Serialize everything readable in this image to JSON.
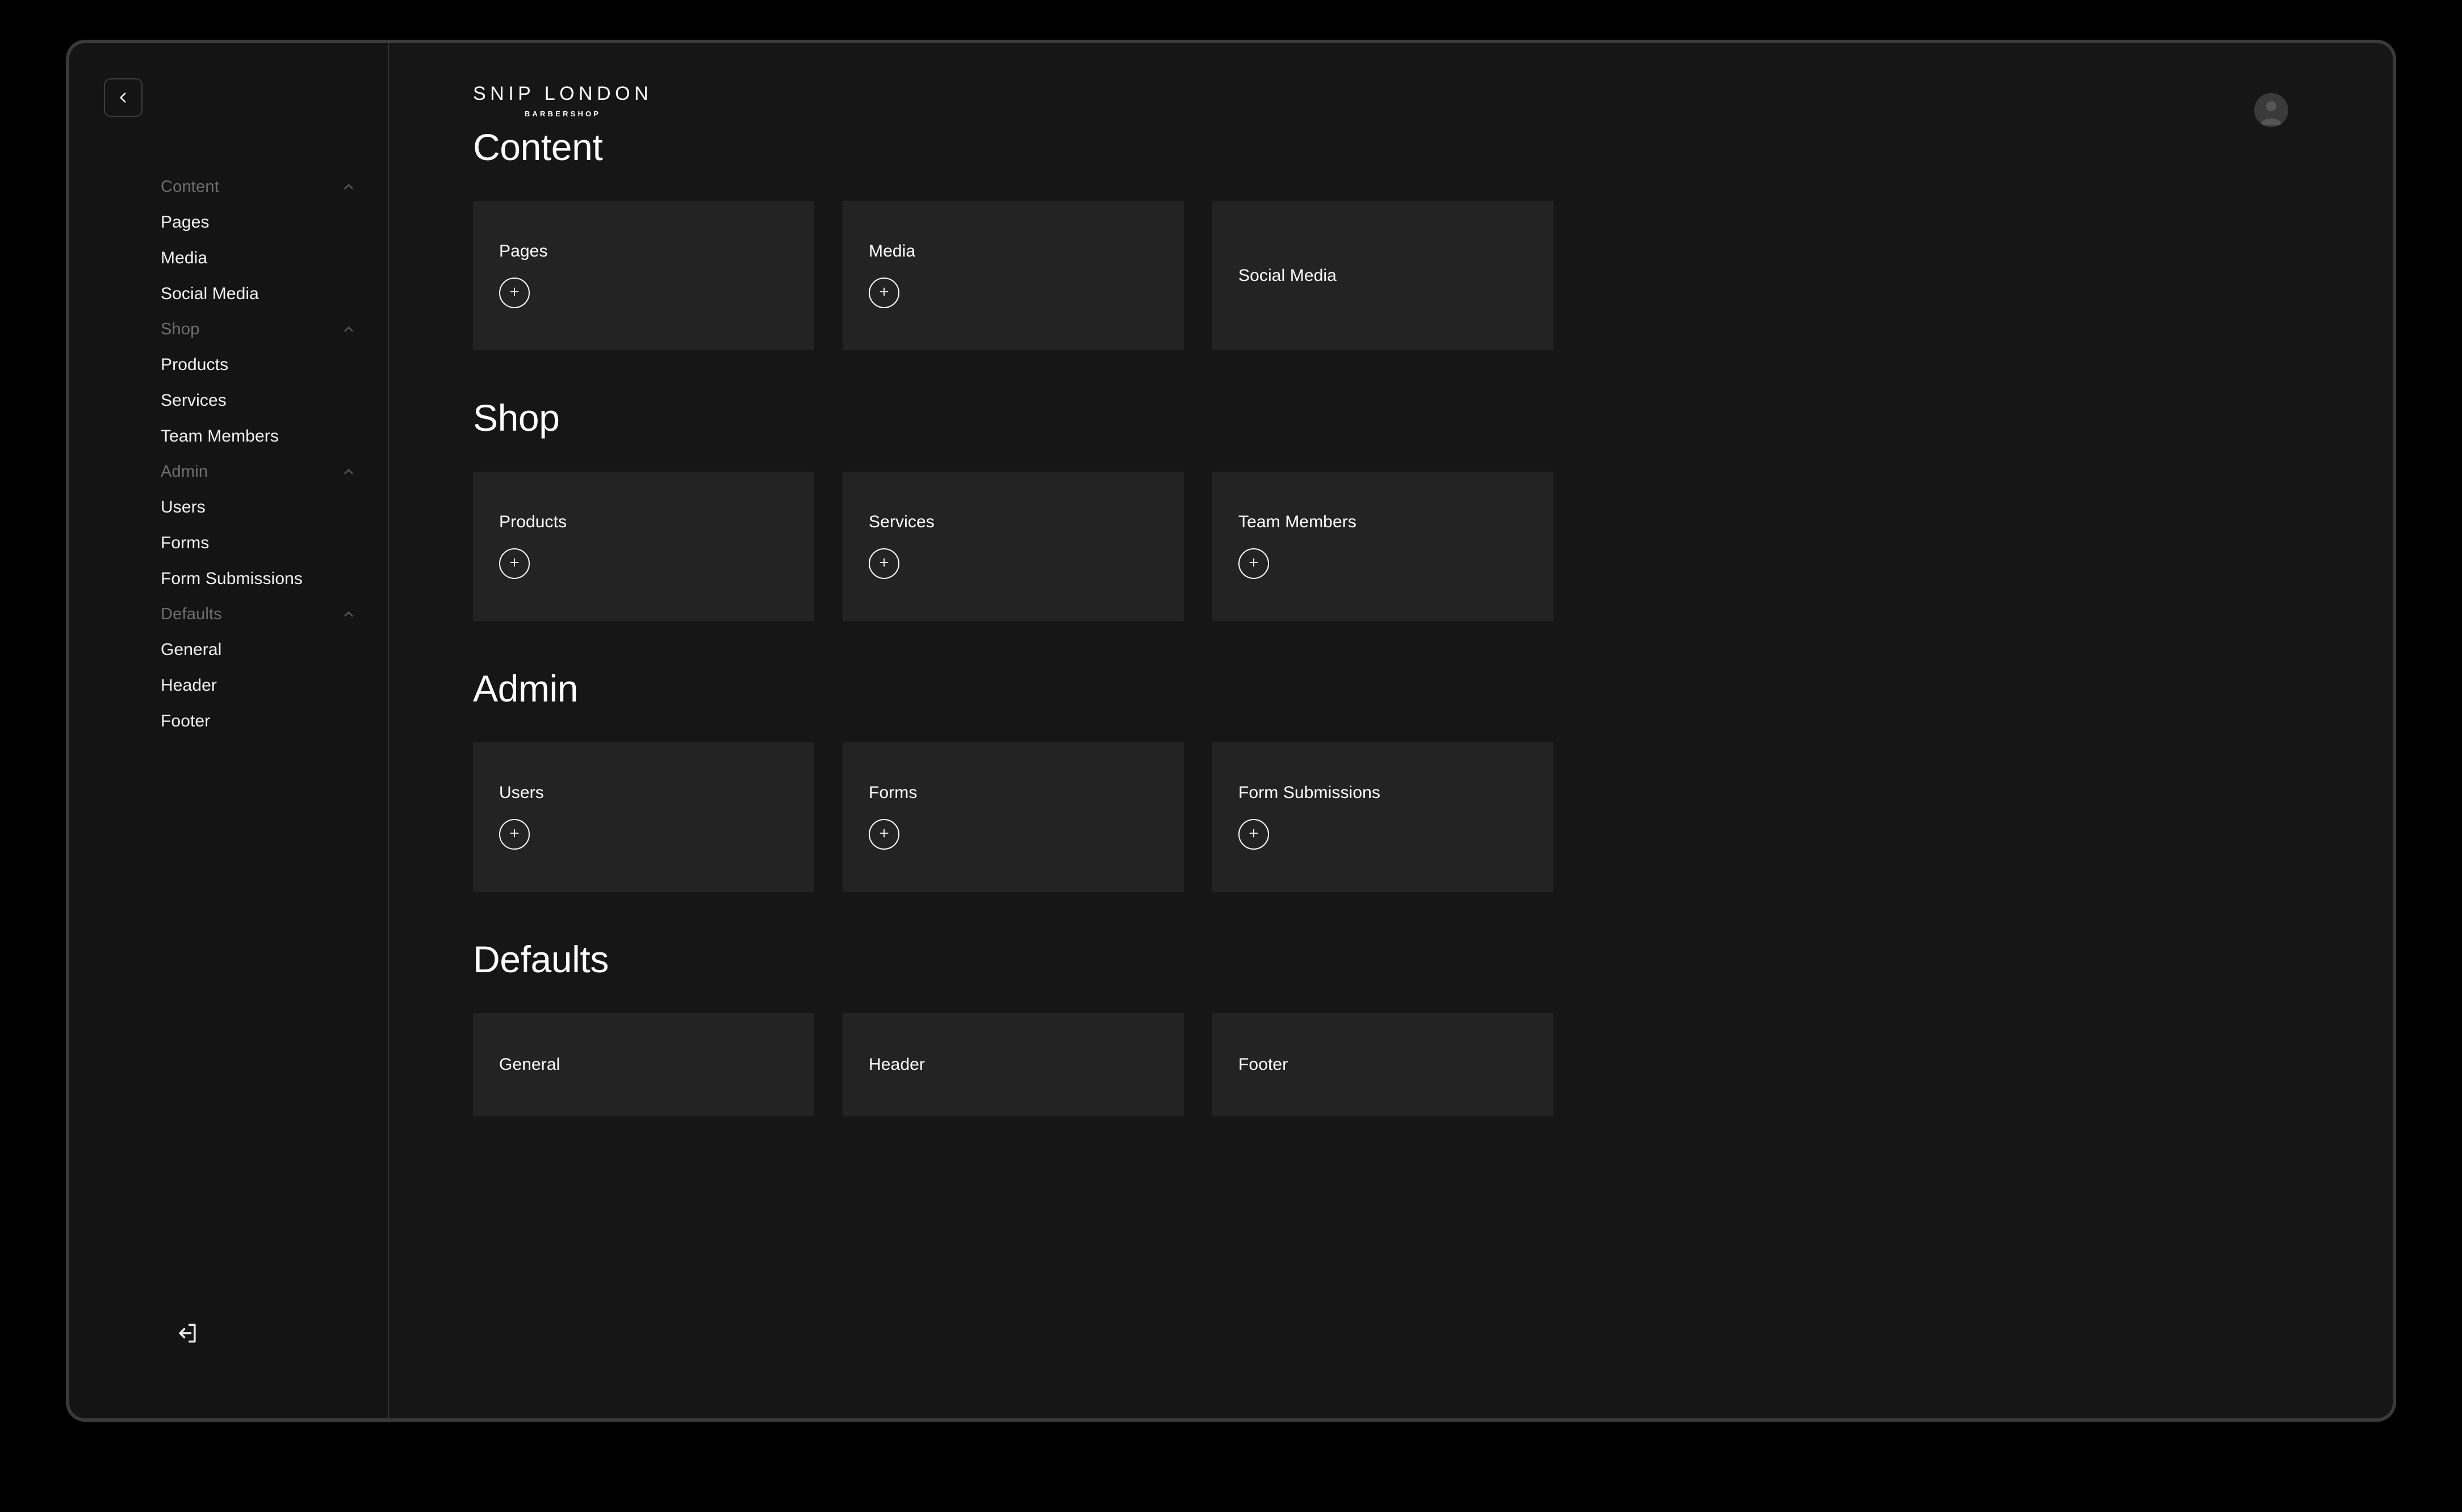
{
  "window": {
    "frame_color": "#3a3a3a",
    "page_background": "#000000",
    "app_background": "#161616",
    "sidebar_background": "#141414",
    "card_background": "#232323"
  },
  "sidebar": {
    "collapse_button_label": "‹",
    "collapse_icon": "chevron-left-icon",
    "logout_icon": "logout-icon",
    "groups": [
      {
        "title": "Content",
        "chevron": "chevron-up-icon",
        "items": [
          {
            "label": "Pages"
          },
          {
            "label": "Media"
          },
          {
            "label": "Social Media"
          }
        ]
      },
      {
        "title": "Shop",
        "chevron": "chevron-up-icon",
        "items": [
          {
            "label": "Products"
          },
          {
            "label": "Services"
          },
          {
            "label": "Team Members"
          }
        ]
      },
      {
        "title": "Admin",
        "chevron": "chevron-up-icon",
        "items": [
          {
            "label": "Users"
          },
          {
            "label": "Forms"
          },
          {
            "label": "Form Submissions"
          }
        ]
      },
      {
        "title": "Defaults",
        "chevron": "chevron-up-icon",
        "items": [
          {
            "label": "General"
          },
          {
            "label": "Header"
          },
          {
            "label": "Footer"
          }
        ]
      }
    ]
  },
  "topbar": {
    "brand_name": "SNIP LONDON",
    "brand_subtitle": "BARBERSHOP",
    "avatar_icon": "user-avatar-icon"
  },
  "main": {
    "sections": [
      {
        "title": "Content",
        "card_height": "tall",
        "cards": [
          {
            "title": "Pages",
            "add_button": true,
            "add_icon": "plus-icon"
          },
          {
            "title": "Media",
            "add_button": true,
            "add_icon": "plus-icon"
          },
          {
            "title": "Social Media",
            "add_button": false
          }
        ]
      },
      {
        "title": "Shop",
        "card_height": "tall",
        "cards": [
          {
            "title": "Products",
            "add_button": true,
            "add_icon": "plus-icon"
          },
          {
            "title": "Services",
            "add_button": true,
            "add_icon": "plus-icon"
          },
          {
            "title": "Team Members",
            "add_button": true,
            "add_icon": "plus-icon"
          }
        ]
      },
      {
        "title": "Admin",
        "card_height": "tall",
        "cards": [
          {
            "title": "Users",
            "add_button": true,
            "add_icon": "plus-icon"
          },
          {
            "title": "Forms",
            "add_button": true,
            "add_icon": "plus-icon"
          },
          {
            "title": "Form Submissions",
            "add_button": true,
            "add_icon": "plus-icon"
          }
        ]
      },
      {
        "title": "Defaults",
        "card_height": "short",
        "cards": [
          {
            "title": "General",
            "add_button": false
          },
          {
            "title": "Header",
            "add_button": false
          },
          {
            "title": "Footer",
            "add_button": false
          }
        ]
      }
    ]
  }
}
